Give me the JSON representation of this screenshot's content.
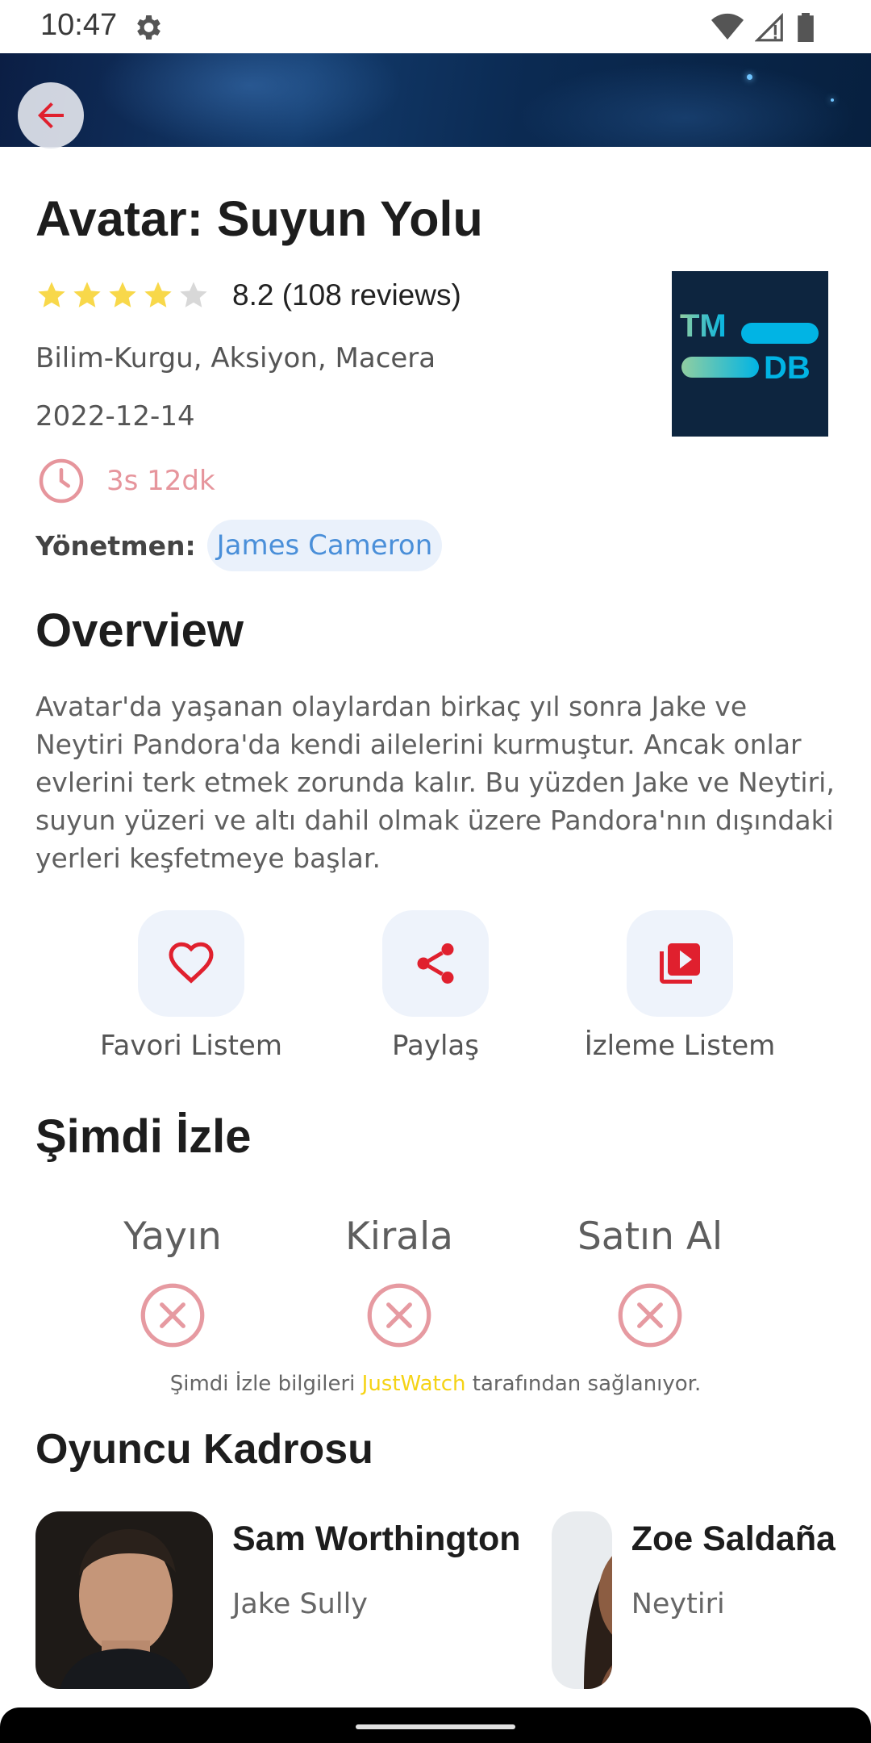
{
  "status_bar": {
    "time": "10:47",
    "icons": [
      "gear-icon",
      "wifi-icon",
      "signal-icon",
      "battery-icon"
    ]
  },
  "movie": {
    "title": "Avatar: Suyun Yolu",
    "rating_stars": 4,
    "rating_max": 5,
    "rating_text": "8.2 (108 reviews)",
    "genres": "Bilim-Kurgu, Aksiyon, Macera",
    "release_date": "2022-12-14",
    "runtime": "3s 12dk",
    "director_label": "Yönetmen:",
    "director_name": "James Cameron",
    "logo": {
      "line1": "TM",
      "line2": "DB"
    }
  },
  "overview": {
    "heading": "Overview",
    "text": "Avatar'da yaşanan olaylardan birkaç yıl sonra Jake ve Neytiri Pandora'da kendi ailelerini kurmuştur. Ancak onlar evlerini terk etmek zorunda kalır. Bu yüzden Jake ve Neytiri, suyun yüzeri ve altı dahil olmak üzere Pandora'nın dışındaki yerleri keşfetmeye başlar."
  },
  "actions": [
    {
      "label": "Favori Listem",
      "icon": "heart-icon"
    },
    {
      "label": "Paylaş",
      "icon": "share-icon"
    },
    {
      "label": "İzleme Listem",
      "icon": "playlist-play-icon"
    }
  ],
  "watch_now": {
    "heading": "Şimdi İzle",
    "columns": [
      {
        "label": "Yayın",
        "status": "unavailable"
      },
      {
        "label": "Kirala",
        "status": "unavailable"
      },
      {
        "label": "Satın Al",
        "status": "unavailable"
      }
    ],
    "credit_prefix": "Şimdi İzle bilgileri ",
    "credit_brand": "JustWatch",
    "credit_suffix": " tarafından sağlanıyor."
  },
  "cast": {
    "heading": "Oyuncu Kadrosu",
    "members": [
      {
        "name": "Sam Worthington",
        "character": "Jake Sully"
      },
      {
        "name": "Zoe Saldaña",
        "character": "Neytiri"
      }
    ]
  },
  "colors": {
    "accent": "#e0202e",
    "star": "#f8d84a",
    "link": "#4a8fd9",
    "runtime": "#e6959c",
    "tmdb_bg": "#0d253f"
  }
}
